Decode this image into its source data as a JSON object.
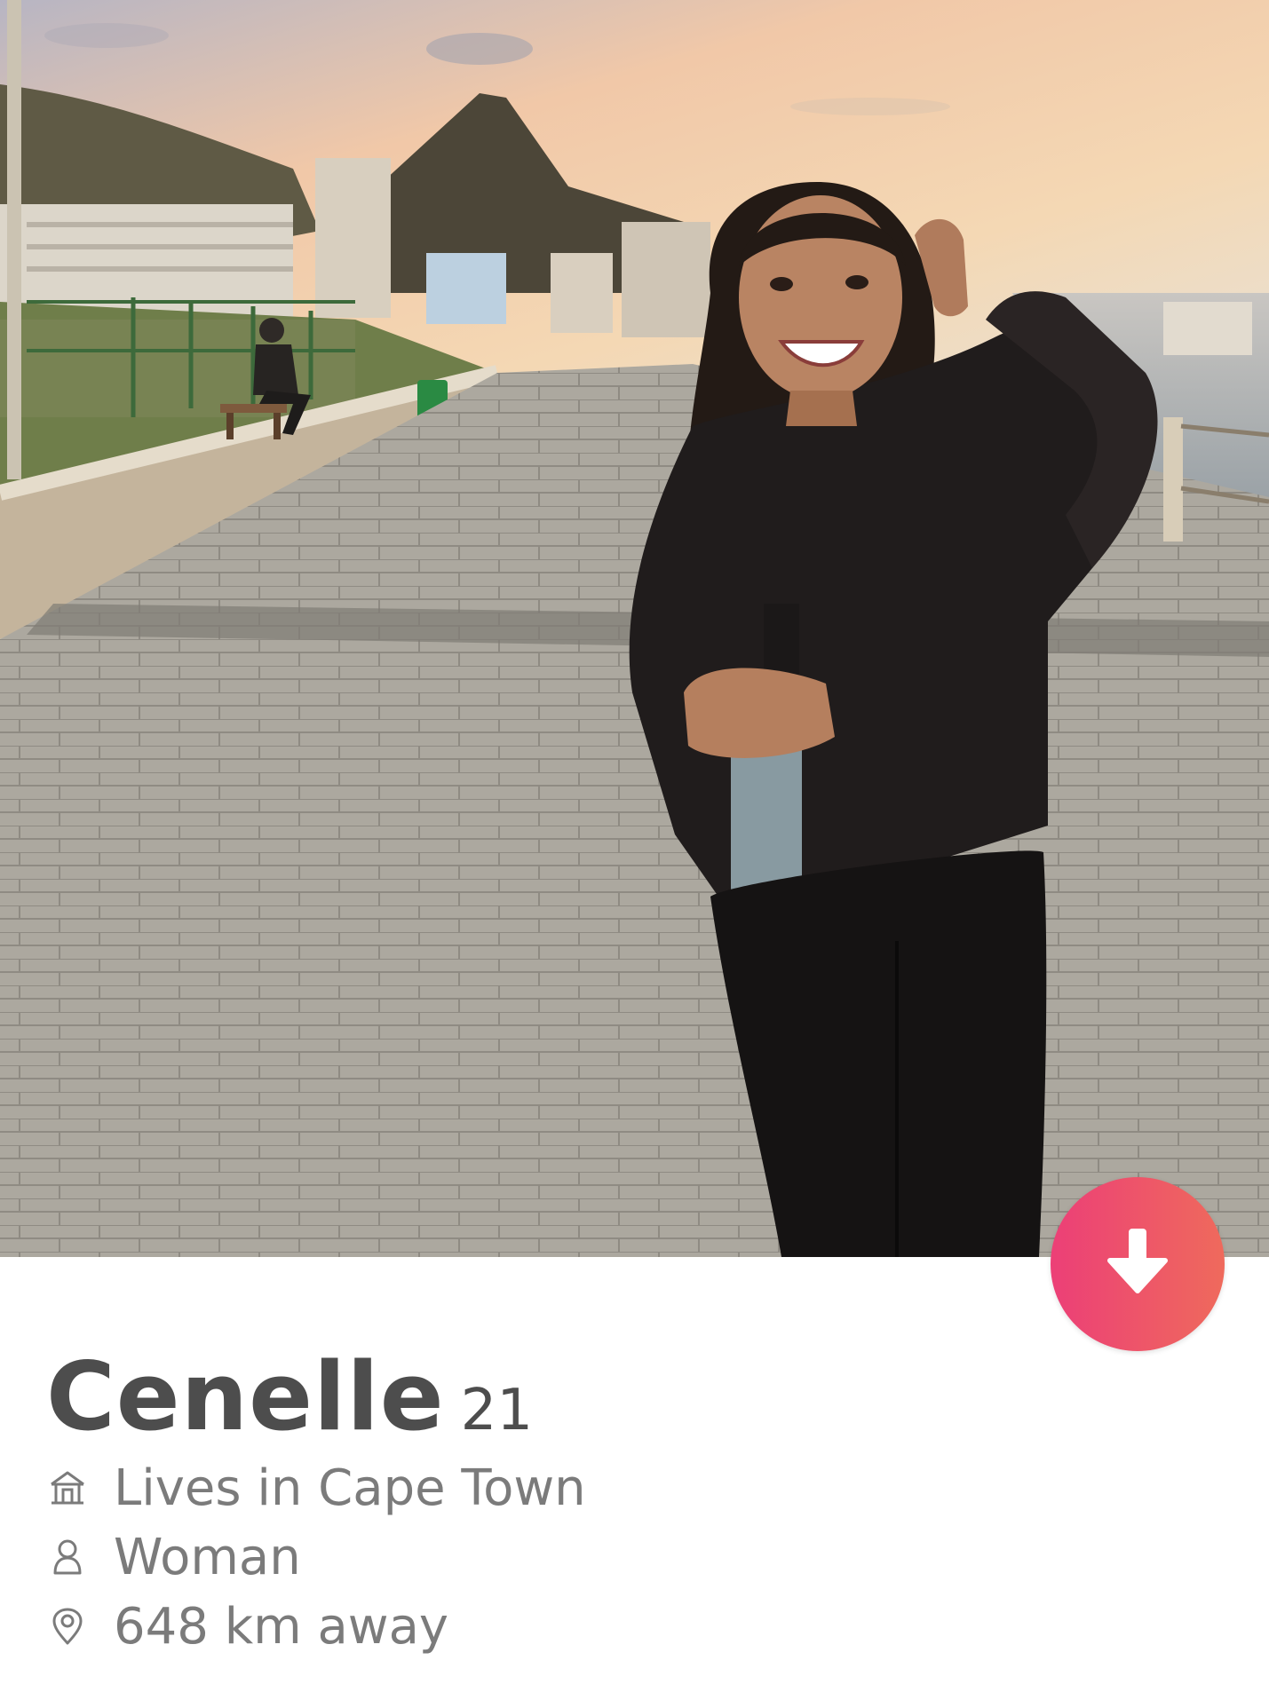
{
  "profile": {
    "name": "Cenelle",
    "age": "21",
    "city": "Lives in Cape Town",
    "gender": "Woman",
    "distance": "648 km away"
  },
  "icons": {
    "city": "home-icon",
    "gender": "person-icon",
    "distance": "location-pin-icon",
    "collapse": "arrow-down-icon"
  },
  "colors": {
    "name_text": "#4d4d4d",
    "detail_text": "#7b7b7b",
    "button_gradient_start": "#ec3f77",
    "button_gradient_end": "#ef6a5c"
  }
}
